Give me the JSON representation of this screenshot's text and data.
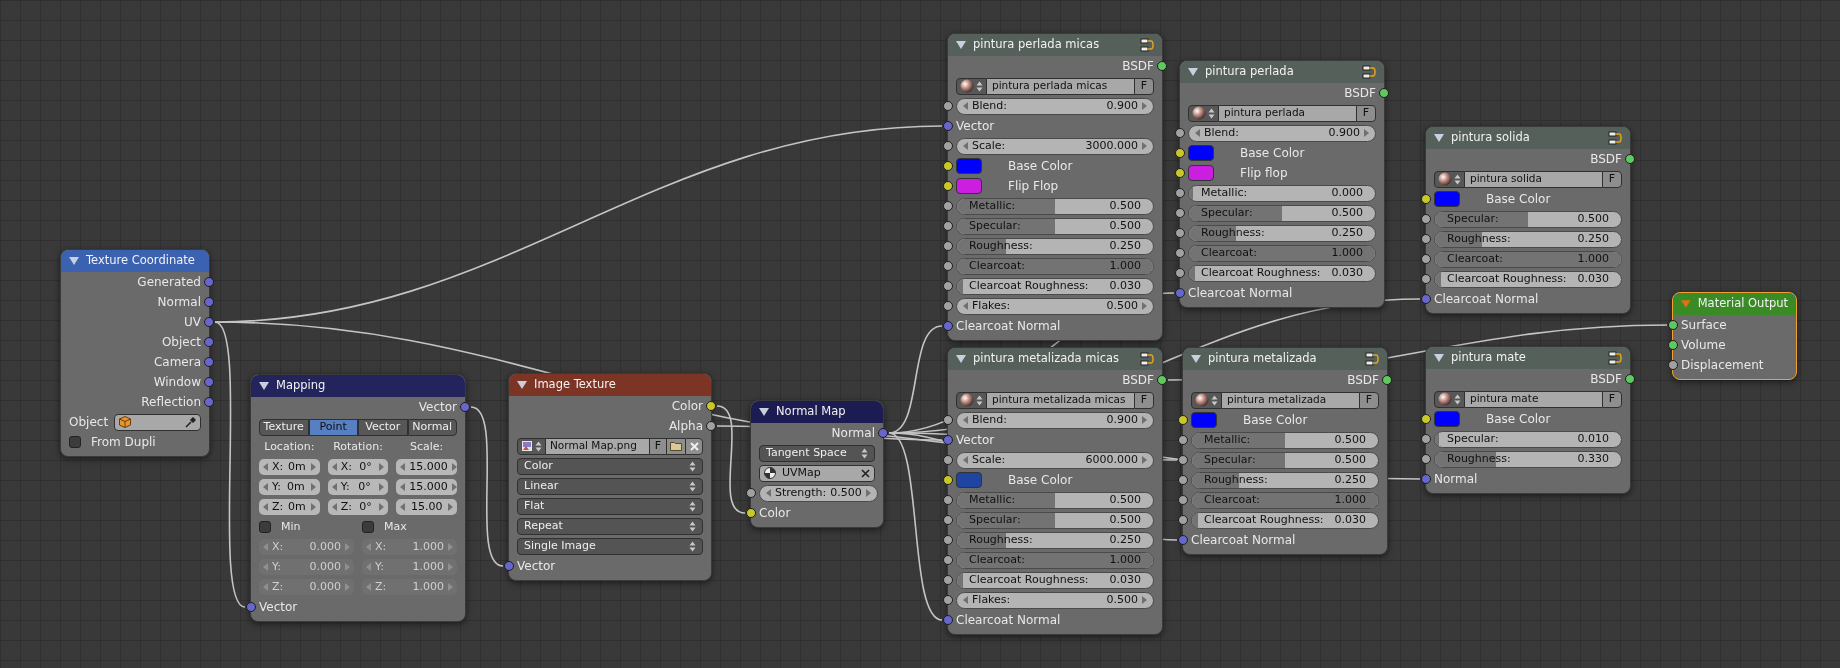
{
  "nodes": [
    {
      "title": "Texture Coordinate",
      "color": "#3a62b0",
      "group": false,
      "selected": false,
      "rows": [
        {
          "kind": "output",
          "label": "Generated",
          "socket": {
            "color": "#6666cc"
          }
        },
        {
          "kind": "output",
          "label": "Normal",
          "socket": {
            "color": "#6666cc"
          }
        },
        {
          "kind": "output",
          "label": "UV",
          "socket": {
            "color": "#6666cc"
          }
        },
        {
          "kind": "output",
          "label": "Object",
          "socket": {
            "color": "#6666cc"
          }
        },
        {
          "kind": "output",
          "label": "Camera",
          "socket": {
            "color": "#6666cc"
          }
        },
        {
          "kind": "output",
          "label": "Window",
          "socket": {
            "color": "#6666cc"
          }
        },
        {
          "kind": "output",
          "label": "Reflection",
          "socket": {
            "color": "#6666cc"
          }
        },
        {
          "kind": "object",
          "label": "Object"
        },
        {
          "kind": "checkbox",
          "label": "From Dupli",
          "checked": false
        }
      ]
    },
    {
      "title": "Mapping",
      "color": "#24245c",
      "group": false,
      "selected": false,
      "rows": [
        {
          "kind": "output",
          "label": "Vector",
          "socket": {
            "color": "#6666cc"
          }
        },
        {
          "kind": "tabs",
          "options": [
            {
              "label": "Texture",
              "selected": false
            },
            {
              "label": "Point",
              "selected": true
            },
            {
              "label": "Vector",
              "selected": false
            },
            {
              "label": "Normal",
              "selected": false
            }
          ]
        },
        {
          "kind": "labels",
          "texts": [
            "Location:",
            "Rotation:",
            "Scale:"
          ]
        },
        {
          "kind": "fields",
          "disabled": false,
          "cells": [
            {
              "axis": "X:",
              "value": "0m"
            },
            {
              "axis": "X:",
              "value": "0°"
            },
            {
              "value": "15.000"
            }
          ]
        },
        {
          "kind": "fields",
          "disabled": false,
          "cells": [
            {
              "axis": "Y:",
              "value": "0m"
            },
            {
              "axis": "Y:",
              "value": "0°"
            },
            {
              "value": "15.000"
            }
          ]
        },
        {
          "kind": "fields",
          "disabled": false,
          "cells": [
            {
              "axis": "Z:",
              "value": "0m"
            },
            {
              "axis": "Z:",
              "value": "0°"
            },
            {
              "value": "15.00"
            }
          ]
        },
        {
          "kind": "checks",
          "items": [
            {
              "label": "Min",
              "checked": false
            },
            {
              "label": "Max",
              "checked": false
            }
          ]
        },
        {
          "kind": "fields",
          "disabled": true,
          "cells": [
            {
              "axis": "X:",
              "value": "0.000"
            },
            {
              "axis": "X:",
              "value": "1.000"
            }
          ]
        },
        {
          "kind": "fields",
          "disabled": true,
          "cells": [
            {
              "axis": "Y:",
              "value": "0.000"
            },
            {
              "axis": "Y:",
              "value": "1.000"
            }
          ]
        },
        {
          "kind": "fields",
          "disabled": true,
          "cells": [
            {
              "axis": "Z:",
              "value": "0.000"
            },
            {
              "axis": "Z:",
              "value": "1.000"
            }
          ]
        },
        {
          "kind": "input",
          "label": "Vector",
          "socket": {
            "color": "#6666cc"
          }
        }
      ]
    },
    {
      "title": "Image Texture",
      "color": "#7c3425",
      "group": false,
      "selected": false,
      "rows": [
        {
          "kind": "output",
          "label": "Color",
          "socket": {
            "color": "#c8c82a"
          }
        },
        {
          "kind": "output",
          "label": "Alpha",
          "socket": {
            "color": "#a1a1a1"
          }
        },
        {
          "kind": "image",
          "value": "Normal Map.png",
          "button": "F"
        },
        {
          "kind": "dropdown",
          "label": "Color"
        },
        {
          "kind": "dropdown",
          "label": "Linear"
        },
        {
          "kind": "dropdown",
          "label": "Flat"
        },
        {
          "kind": "dropdown",
          "label": "Repeat"
        },
        {
          "kind": "dropdown",
          "label": "Single Image"
        },
        {
          "kind": "input",
          "label": "Vector",
          "socket": {
            "color": "#6666cc"
          }
        }
      ]
    },
    {
      "title": "Normal Map",
      "color": "#1c1c52",
      "group": false,
      "selected": false,
      "rows": [
        {
          "kind": "output",
          "label": "Normal",
          "socket": {
            "color": "#6666cc"
          }
        },
        {
          "kind": "dropdown",
          "label": "Tangent Space"
        },
        {
          "kind": "uvmap",
          "value": "UVMap"
        },
        {
          "kind": "number",
          "label": "Strength:",
          "value": "0.500",
          "socket": {
            "color": "#a1a1a1"
          }
        },
        {
          "kind": "input",
          "label": "Color",
          "socket": {
            "color": "#c8c82a"
          }
        }
      ]
    },
    {
      "title": "pintura perlada micas",
      "color": "#56605b",
      "group": true,
      "selected": false,
      "rows": [
        {
          "kind": "output",
          "label": "BSDF",
          "socket": {
            "color": "#5fc85f"
          }
        },
        {
          "kind": "material",
          "value": "pintura perlada micas",
          "button": "F"
        },
        {
          "kind": "number",
          "label": "Blend:",
          "value": "0.900",
          "socket": {
            "color": "#a1a1a1"
          }
        },
        {
          "kind": "input",
          "label": "Vector",
          "socket": {
            "color": "#6666cc"
          }
        },
        {
          "kind": "number",
          "label": "Scale:",
          "value": "3000.000",
          "socket": {
            "color": "#a1a1a1"
          }
        },
        {
          "kind": "color",
          "label": "Base Color",
          "color": "#0000ff",
          "socket": {
            "color": "#c8c82a"
          }
        },
        {
          "kind": "color",
          "label": "Flip Flop",
          "color": "#cc1ee0",
          "socket": {
            "color": "#c8c82a"
          }
        },
        {
          "kind": "slider",
          "label": "Metallic:",
          "value": "0.500",
          "level": 0.5,
          "socket": {
            "color": "#a1a1a1"
          }
        },
        {
          "kind": "slider",
          "label": "Specular:",
          "value": "0.500",
          "level": 0.5,
          "socket": {
            "color": "#a1a1a1"
          }
        },
        {
          "kind": "slider",
          "label": "Roughness:",
          "value": "0.250",
          "level": 0.25,
          "socket": {
            "color": "#a1a1a1"
          }
        },
        {
          "kind": "slider",
          "label": "Clearcoat:",
          "value": "1.000",
          "level": 1,
          "socket": {
            "color": "#a1a1a1"
          }
        },
        {
          "kind": "slider",
          "label": "Clearcoat Roughness:",
          "value": "0.030",
          "level": 0.03,
          "socket": {
            "color": "#a1a1a1"
          }
        },
        {
          "kind": "number",
          "label": "Flakes:",
          "value": "0.500",
          "socket": {
            "color": "#a1a1a1"
          }
        },
        {
          "kind": "input",
          "label": "Clearcoat Normal",
          "socket": {
            "color": "#6666cc"
          }
        }
      ]
    },
    {
      "title": "pintura metalizada micas",
      "color": "#56605b",
      "group": true,
      "selected": false,
      "rows": [
        {
          "kind": "output",
          "label": "BSDF",
          "socket": {
            "color": "#5fc85f"
          }
        },
        {
          "kind": "material",
          "value": "pintura metalizada micas",
          "button": "F"
        },
        {
          "kind": "number",
          "label": "Blend:",
          "value": "0.900",
          "socket": {
            "color": "#a1a1a1"
          }
        },
        {
          "kind": "input",
          "label": "Vector",
          "socket": {
            "color": "#6666cc"
          }
        },
        {
          "kind": "number",
          "label": "Scale:",
          "value": "6000.000",
          "socket": {
            "color": "#a1a1a1"
          }
        },
        {
          "kind": "color",
          "label": "Base Color",
          "color": "#1f45a0",
          "socket": {
            "color": "#c8c82a"
          }
        },
        {
          "kind": "slider",
          "label": "Metallic:",
          "value": "0.500",
          "level": 0.5,
          "socket": {
            "color": "#a1a1a1"
          }
        },
        {
          "kind": "slider",
          "label": "Specular:",
          "value": "0.500",
          "level": 0.5,
          "socket": {
            "color": "#a1a1a1"
          }
        },
        {
          "kind": "slider",
          "label": "Roughness:",
          "value": "0.250",
          "level": 0.25,
          "socket": {
            "color": "#a1a1a1"
          }
        },
        {
          "kind": "slider",
          "label": "Clearcoat:",
          "value": "1.000",
          "level": 1,
          "socket": {
            "color": "#a1a1a1"
          }
        },
        {
          "kind": "slider",
          "label": "Clearcoat Roughness:",
          "value": "0.030",
          "level": 0.03,
          "socket": {
            "color": "#a1a1a1"
          }
        },
        {
          "kind": "number",
          "label": "Flakes:",
          "value": "0.500",
          "socket": {
            "color": "#a1a1a1"
          }
        },
        {
          "kind": "input",
          "label": "Clearcoat Normal",
          "socket": {
            "color": "#6666cc"
          }
        }
      ]
    },
    {
      "title": "pintura perlada",
      "color": "#56605b",
      "group": true,
      "selected": false,
      "rows": [
        {
          "kind": "output",
          "label": "BSDF",
          "socket": {
            "color": "#5fc85f"
          }
        },
        {
          "kind": "material",
          "value": "pintura perlada",
          "button": "F"
        },
        {
          "kind": "number",
          "label": "Blend:",
          "value": "0.900",
          "socket": {
            "color": "#a1a1a1"
          }
        },
        {
          "kind": "color",
          "label": "Base Color",
          "color": "#0000ff",
          "socket": {
            "color": "#c8c82a"
          }
        },
        {
          "kind": "color",
          "label": "Flip flop",
          "color": "#cc1ee0",
          "socket": {
            "color": "#c8c82a"
          }
        },
        {
          "kind": "slider",
          "label": "Metallic:",
          "value": "0.000",
          "level": 0,
          "socket": {
            "color": "#a1a1a1"
          }
        },
        {
          "kind": "slider",
          "label": "Specular:",
          "value": "0.500",
          "level": 0.5,
          "socket": {
            "color": "#a1a1a1"
          }
        },
        {
          "kind": "slider",
          "label": "Roughness:",
          "value": "0.250",
          "level": 0.25,
          "socket": {
            "color": "#a1a1a1"
          }
        },
        {
          "kind": "slider",
          "label": "Clearcoat:",
          "value": "1.000",
          "level": 1,
          "socket": {
            "color": "#a1a1a1"
          }
        },
        {
          "kind": "slider",
          "label": "Clearcoat Roughness:",
          "value": "0.030",
          "level": 0.03,
          "socket": {
            "color": "#a1a1a1"
          }
        },
        {
          "kind": "input",
          "label": "Clearcoat Normal",
          "socket": {
            "color": "#6666cc"
          }
        }
      ]
    },
    {
      "title": "pintura metalizada",
      "color": "#56605b",
      "group": true,
      "selected": false,
      "rows": [
        {
          "kind": "output",
          "label": "BSDF",
          "socket": {
            "color": "#5fc85f"
          }
        },
        {
          "kind": "material",
          "value": "pintura metalizada",
          "button": "F"
        },
        {
          "kind": "color",
          "label": "Base Color",
          "color": "#0000ff",
          "socket": {
            "color": "#c8c82a"
          }
        },
        {
          "kind": "slider",
          "label": "Metallic:",
          "value": "0.500",
          "level": 0.5,
          "socket": {
            "color": "#a1a1a1"
          }
        },
        {
          "kind": "slider",
          "label": "Specular:",
          "value": "0.500",
          "level": 0.5,
          "socket": {
            "color": "#a1a1a1"
          }
        },
        {
          "kind": "slider",
          "label": "Roughness:",
          "value": "0.250",
          "level": 0.25,
          "socket": {
            "color": "#a1a1a1"
          }
        },
        {
          "kind": "slider",
          "label": "Clearcoat:",
          "value": "1.000",
          "level": 1,
          "socket": {
            "color": "#a1a1a1"
          }
        },
        {
          "kind": "slider",
          "label": "Clearcoat Roughness:",
          "value": "0.030",
          "level": 0.03,
          "socket": {
            "color": "#a1a1a1"
          }
        },
        {
          "kind": "input",
          "label": "Clearcoat Normal",
          "socket": {
            "color": "#6666cc"
          }
        }
      ]
    },
    {
      "title": "pintura solida",
      "color": "#56605b",
      "group": true,
      "selected": false,
      "rows": [
        {
          "kind": "output",
          "label": "BSDF",
          "socket": {
            "color": "#5fc85f"
          }
        },
        {
          "kind": "material",
          "value": "pintura solida",
          "button": "F"
        },
        {
          "kind": "color",
          "label": "Base Color",
          "color": "#0000ff",
          "socket": {
            "color": "#c8c82a"
          }
        },
        {
          "kind": "slider",
          "label": "Specular:",
          "value": "0.500",
          "level": 0.5,
          "socket": {
            "color": "#a1a1a1"
          }
        },
        {
          "kind": "slider",
          "label": "Roughness:",
          "value": "0.250",
          "level": 0.25,
          "socket": {
            "color": "#a1a1a1"
          }
        },
        {
          "kind": "slider",
          "label": "Clearcoat:",
          "value": "1.000",
          "level": 1,
          "socket": {
            "color": "#a1a1a1"
          }
        },
        {
          "kind": "slider",
          "label": "Clearcoat Roughness:",
          "value": "0.030",
          "level": 0.03,
          "socket": {
            "color": "#a1a1a1"
          }
        },
        {
          "kind": "input",
          "label": "Clearcoat Normal",
          "socket": {
            "color": "#6666cc"
          }
        }
      ]
    },
    {
      "title": "pintura mate",
      "color": "#56605b",
      "group": true,
      "selected": false,
      "rows": [
        {
          "kind": "output",
          "label": "BSDF",
          "socket": {
            "color": "#5fc85f"
          }
        },
        {
          "kind": "material",
          "value": "pintura mate",
          "button": "F"
        },
        {
          "kind": "color",
          "label": "Base Color",
          "color": "#0000ff",
          "socket": {
            "color": "#c8c82a"
          }
        },
        {
          "kind": "slider",
          "label": "Specular:",
          "value": "0.010",
          "level": 0.01,
          "socket": {
            "color": "#a1a1a1"
          }
        },
        {
          "kind": "slider",
          "label": "Roughness:",
          "value": "0.330",
          "level": 0.33,
          "socket": {
            "color": "#a1a1a1"
          }
        },
        {
          "kind": "input",
          "label": "Normal",
          "socket": {
            "color": "#6666cc"
          }
        }
      ]
    },
    {
      "title": "Material Output",
      "color": "#3a8a26",
      "group": false,
      "selected": true,
      "rows": [
        {
          "kind": "input",
          "label": "Surface",
          "socket": {
            "color": "#5fc85f"
          }
        },
        {
          "kind": "input",
          "label": "Volume",
          "socket": {
            "color": "#5fc85f"
          }
        },
        {
          "kind": "input",
          "label": "Displacement",
          "socket": {
            "color": "#a1a1a1"
          }
        }
      ]
    }
  ]
}
